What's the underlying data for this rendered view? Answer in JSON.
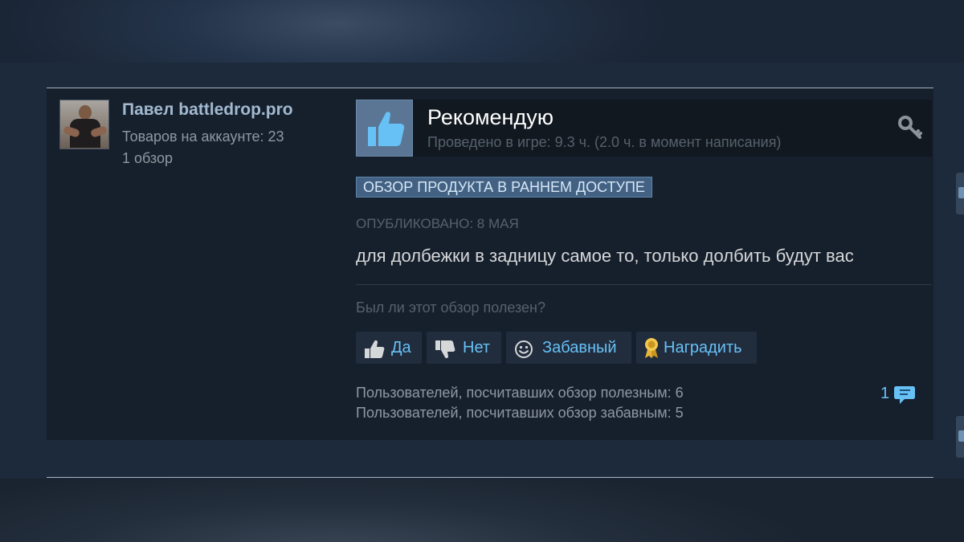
{
  "author": {
    "name": "Павел battledrop.pro",
    "products": "Товаров на аккаунте: 23",
    "reviews": "1 обзор"
  },
  "review": {
    "verdict": "Рекомендую",
    "hours": "Проведено в игре: 9.3 ч. (2.0 ч. в момент написания)",
    "early_access_badge": "ОБЗОР ПРОДУКТА В РАННЕМ ДОСТУПЕ",
    "posted": "ОПУБЛИКОВАНО: 8 МАЯ",
    "text": "для долбежки в задницу самое то, только долбить будут вас"
  },
  "feedback": {
    "question": "Был ли этот обзор полезен?",
    "buttons": {
      "yes": "Да",
      "no": "Нет",
      "funny": "Забавный",
      "award": "Наградить"
    },
    "helpful_count": "Пользователей, посчитавших обзор полезным: 6",
    "funny_count": "Пользователей, посчитавших обзор забавным: 5",
    "comments_count": "1"
  },
  "colors": {
    "page_bg": "#1b2838",
    "card_bg": "#16202d",
    "link_blue": "#67c1f5",
    "muted_text": "#56616c",
    "body_text": "#d6d7d8"
  },
  "icons": [
    "thumbs-up-icon",
    "key-icon",
    "thumbs-up-small-icon",
    "thumbs-down-icon",
    "smiley-icon",
    "award-ribbon-icon",
    "comment-bubble-icon"
  ]
}
